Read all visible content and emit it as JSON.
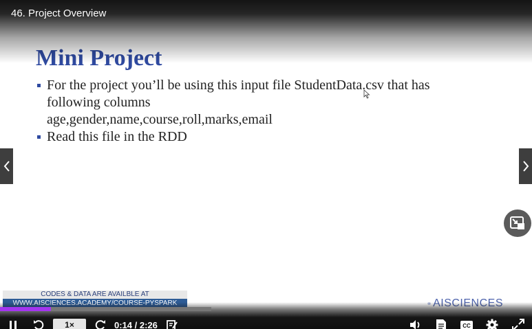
{
  "header": {
    "title": "46. Project Overview"
  },
  "slide": {
    "title": "Mini Project",
    "bullets": [
      {
        "lines": [
          "For the project you’ll be using this input file StudentData.csv that has",
          "following columns",
          "age,gender,name,course,roll,marks,email"
        ]
      },
      {
        "lines": [
          "Read this file in the RDD"
        ]
      }
    ],
    "banner": {
      "line1": "CODES & DATA ARE AVAILBLE AT",
      "line2": "WWW.AISCIENCES.ACADEMY/COURSE-PYSPARK"
    },
    "logo_text": "AISCIENCES"
  },
  "controls": {
    "speed_label": "1×",
    "time": "0:14 / 2:26",
    "progress_fraction": 0.096,
    "accent_color": "#a435f0"
  },
  "icons": {
    "play_state": "pause-icon",
    "prev": "chevron-left-icon",
    "next": "chevron-right-icon",
    "pip": "picture-in-picture-icon"
  }
}
